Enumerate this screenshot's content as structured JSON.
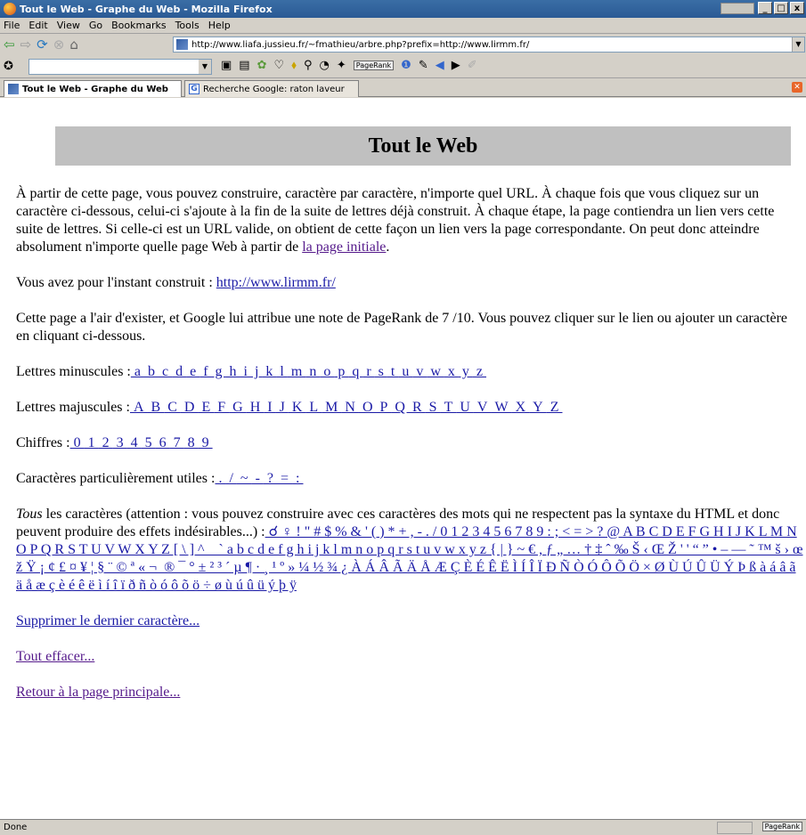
{
  "window": {
    "title": "Tout le Web - Graphe du Web - Mozilla Firefox"
  },
  "menu": [
    "File",
    "Edit",
    "View",
    "Go",
    "Bookmarks",
    "Tools",
    "Help"
  ],
  "url": "http://www.liafa.jussieu.fr/~fmathieu/arbre.php?prefix=http://www.lirmm.fr/",
  "search": {
    "value": "",
    "pagerank_label": "PageRank"
  },
  "tabs": [
    {
      "label": "Tout le Web - Graphe du Web"
    },
    {
      "label": "Recherche Google: raton laveur"
    }
  ],
  "page": {
    "heading": "Tout le Web",
    "intro": "À partir de cette page, vous pouvez construire, caractère par caractère, n'importe quel URL. À chaque fois que vous cliquez sur un caractère ci-dessous, celui-ci s'ajoute à la fin de la suite de lettres déjà construit. À chaque étape, la page contiendra un lien vers cette suite de lettres. Si celle-ci est un URL valide, on obtient de cette façon un lien vers la page correspondante. On peut donc atteindre absolument n'importe quelle page Web à partir de ",
    "intro_link": "la page initiale",
    "intro_end": ".",
    "built_prefix": "Vous avez pour l'instant construit : ",
    "built_url": "http://www.lirmm.fr/",
    "pagerank_text": "Cette page a l'air d'exister, et Google lui attribue une note de PageRank de 7 /10. Vous pouvez cliquer sur le lien ou ajouter un caractère en cliquant ci-dessous.",
    "lower_label": "Lettres minuscules :",
    "lower": [
      "a",
      "b",
      "c",
      "d",
      "e",
      "f",
      "g",
      "h",
      "i",
      "j",
      "k",
      "l",
      "m",
      "n",
      "o",
      "p",
      "q",
      "r",
      "s",
      "t",
      "u",
      "v",
      "w",
      "x",
      "y",
      "z"
    ],
    "upper_label": "Lettres majuscules :",
    "upper": [
      "A",
      "B",
      "C",
      "D",
      "E",
      "F",
      "G",
      "H",
      "I",
      "J",
      "K",
      "L",
      "M",
      "N",
      "O",
      "P",
      "Q",
      "R",
      "S",
      "T",
      "U",
      "V",
      "W",
      "X",
      "Y",
      "Z"
    ],
    "digits_label": "Chiffres :",
    "digits": [
      "0",
      "1",
      "2",
      "3",
      "4",
      "5",
      "6",
      "7",
      "8",
      "9"
    ],
    "useful_label": "Caractères particulièrement utiles :",
    "useful": [
      ".",
      "/",
      "~",
      "-",
      "?",
      "=",
      ":"
    ],
    "all_label_em": "Tous",
    "all_label": " les caractères (attention : vous pouvez construire avec ces caractères des mots qui ne respectent pas la syntaxe du HTML et donc peuvent produire des effets indésirables...) :",
    "all_chars": "          ☌ ♀                ! \" # $ % & ' ( ) * + , - . / 0 1 2 3 4 5 6 7 8 9 : ; < = > ? @ A B C D E F G H I J K L M N O P Q R S T U V W X Y Z [ \\ ] ^ _ ` a b c d e f g h i j k l m n o p q r s t u v w x y z { | } ~   € , ƒ „ … † ‡ ˆ ‰ Š ‹ Œ   Ž     ' ' “ ” • – — ˜ ™ š › œ   ž Ÿ   ¡ ¢ £ ¤ ¥ ¦ § ¨ © ª « ¬ ­ ® ¯ ° ± ² ³ ´ µ ¶ · ¸ ¹ º » ¼ ½ ¾ ¿ À Á Â Ã Ä Å Æ Ç È É Ê Ë Ì Í Î Ï Ð Ñ Ò Ó Ô Õ Ö × Ø Ù Ú Û Ü Ý Þ ß à á â ã ä å æ ç è é ê ë ì í î ï ð ñ ò ó ô õ ö ÷ ø ù ú û ü ý þ ÿ",
    "delete_last": "Supprimer le dernier caractère...",
    "clear_all": "Tout effacer...",
    "back_main": "Retour à la page principale..."
  },
  "status": {
    "text": "Done",
    "pagerank": "PageRank"
  }
}
